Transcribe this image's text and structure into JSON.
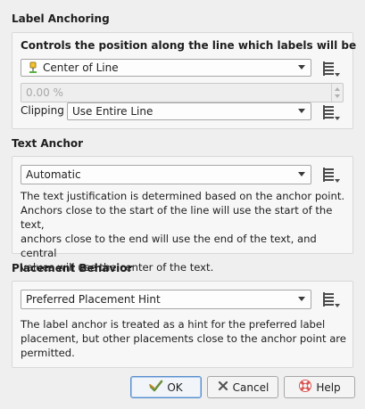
{
  "label_anchoring": {
    "title": "Label Anchoring",
    "subtitle": "Controls the position along the line which labels will be",
    "position_combo": "Center of Line",
    "percent_value": "0.00 %",
    "clipping_label": "Clipping",
    "clipping_combo": "Use Entire Line"
  },
  "text_anchor": {
    "title": "Text Anchor",
    "combo": "Automatic",
    "help": [
      "The text justification is determined based on the anchor point.",
      "Anchors close to the start of the line will use the start of the text,",
      "anchors close to the end will use the end of the text, and central",
      "values will use the center of the text."
    ]
  },
  "placement_behavior": {
    "title": "Placement Behavior",
    "combo": "Preferred Placement Hint",
    "help": [
      "The label anchor is treated as a hint for the preferred label",
      "placement, but other placements close to the anchor point are",
      "permitted."
    ]
  },
  "buttons": {
    "ok": "OK",
    "cancel": "Cancel",
    "help": "Help"
  },
  "icons": {
    "data_defined": "data-defined-override-icon",
    "center_of_line": "pin-icon",
    "ok": "ok-check-icon",
    "cancel": "cancel-x-icon",
    "help": "help-lifebuoy-icon"
  }
}
